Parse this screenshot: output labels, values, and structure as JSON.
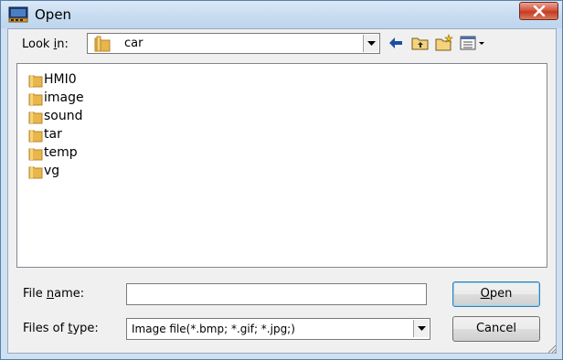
{
  "window": {
    "title": "Open"
  },
  "lookin": {
    "label_pre": "Look ",
    "label_u": "i",
    "label_post": "n:",
    "value": "car"
  },
  "toolbar": {
    "icons": [
      "back-arrow-icon",
      "up-folder-icon",
      "new-folder-icon",
      "view-menu-icon"
    ]
  },
  "files": [
    {
      "name": "HMI0"
    },
    {
      "name": "image"
    },
    {
      "name": "sound"
    },
    {
      "name": "tar"
    },
    {
      "name": "temp"
    },
    {
      "name": "vg"
    }
  ],
  "filename": {
    "label_pre": "File ",
    "label_u": "n",
    "label_post": "ame:",
    "value": ""
  },
  "filetype": {
    "label_pre": "Files of ",
    "label_u": "t",
    "label_post": "ype:",
    "value": "Image file(*.bmp; *.gif; *.jpg;)"
  },
  "buttons": {
    "open_u": "O",
    "open_rest": "pen",
    "cancel": "Cancel"
  },
  "colors": {
    "folder": "#e8b64a",
    "close": "#c43b22",
    "title_bg": "#c7dcf1"
  }
}
